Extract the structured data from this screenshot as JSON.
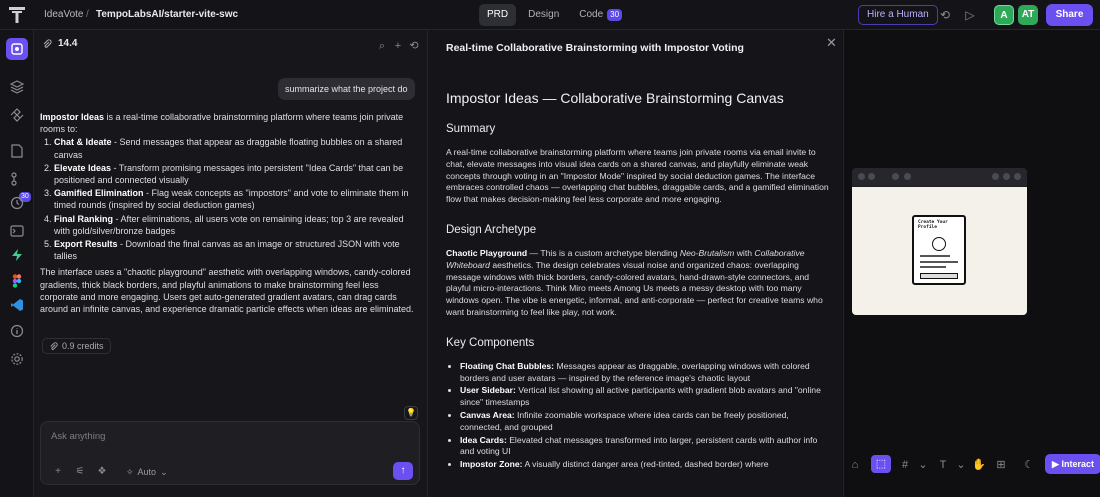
{
  "topbar": {
    "project": "IdeaVote",
    "separator": "/",
    "repo": "TempoLabsAI/starter-vite-swc",
    "tabs": [
      {
        "label": "PRD",
        "active": true
      },
      {
        "label": "Design",
        "active": false
      },
      {
        "label": "Code",
        "active": false,
        "badge": "30"
      }
    ],
    "hire_label": "Hire a Human",
    "avatars": [
      {
        "initials": "A",
        "color": "#2fa85a"
      },
      {
        "initials": "AT",
        "color": "#2fa85a"
      }
    ],
    "share_label": "Share"
  },
  "rail": {
    "code_badge": "30"
  },
  "chat": {
    "credits_count": "14.4",
    "user_message": "summarize what the project do",
    "answer": {
      "intro_bold": "Impostor Ideas",
      "intro_rest": " is a real-time collaborative brainstorming platform where teams join private rooms to:",
      "items": [
        {
          "title": "Chat & Ideate",
          "text": " - Send messages that appear as draggable floating bubbles on a shared canvas"
        },
        {
          "title": "Elevate Ideas",
          "text": " - Transform promising messages into persistent \"Idea Cards\" that can be positioned and connected visually"
        },
        {
          "title": "Gamified Elimination",
          "text": " - Flag weak concepts as \"impostors\" and vote to eliminate them in timed rounds (inspired by social deduction games)"
        },
        {
          "title": "Final Ranking",
          "text": " - After eliminations, all users vote on remaining ideas; top 3 are revealed with gold/silver/bronze badges"
        },
        {
          "title": "Export Results",
          "text": " - Download the final canvas as an image or structured JSON with vote tallies"
        }
      ],
      "outro": "The interface uses a \"chaotic playground\" aesthetic with overlapping windows, candy-colored gradients, thick black borders, and playful animations to make brainstorming feel less corporate and more engaging. Users get auto-generated gradient avatars, can drag cards around an infinite canvas, and experience dramatic particle effects when ideas are eliminated."
    },
    "credits_used": "0.9 credits",
    "input_placeholder": "Ask anything",
    "mode_label": "Auto"
  },
  "doc": {
    "panel_title": "Real-time Collaborative Brainstorming with Impostor Voting",
    "h1": "Impostor Ideas — Collaborative Brainstorming Canvas",
    "summary_heading": "Summary",
    "summary": "A real-time collaborative brainstorming platform where teams join private rooms via email invite to chat, elevate messages into visual idea cards on a shared canvas, and playfully eliminate weak concepts through voting in an \"Impostor Mode\" inspired by social deduction games. The interface embraces controlled chaos — overlapping chat bubbles, draggable cards, and a gamified elimination flow that makes decision-making feel less corporate and more engaging.",
    "archetype_heading": "Design Archetype",
    "archetype_bold": "Chaotic Playground",
    "archetype_pre": " — This is a custom archetype blending ",
    "archetype_em1": "Neo-Brutalism",
    "archetype_mid": " with ",
    "archetype_em2": "Collaborative Whiteboard",
    "archetype_rest": " aesthetics. The design celebrates visual noise and organized chaos: overlapping message windows with thick borders, candy-colored avatars, hand-drawn-style connectors, and playful micro-interactions. Think Miro meets Among Us meets a messy desktop with too many windows open. The vibe is energetic, informal, and anti-corporate — perfect for creative teams who want brainstorming to feel like play, not work.",
    "components_heading": "Key Components",
    "components": [
      {
        "title": "Floating Chat Bubbles:",
        "text": " Messages appear as draggable, overlapping windows with colored borders and user avatars — inspired by the reference image's chaotic layout"
      },
      {
        "title": "User Sidebar:",
        "text": " Vertical list showing all active participants with gradient blob avatars and \"online since\" timestamps"
      },
      {
        "title": "Canvas Area:",
        "text": " Infinite zoomable workspace where idea cards can be freely positioned, connected, and grouped"
      },
      {
        "title": "Idea Cards:",
        "text": " Elevated chat messages transformed into larger, persistent cards with author info and voting UI"
      },
      {
        "title": "Impostor Zone:",
        "text": " A visually distinct danger area (red-tinted, dashed border) where"
      }
    ]
  },
  "preview": {
    "card_title": "Create Your Profile",
    "interact_label": "Interact"
  },
  "colors": {
    "accent": "#6b4ff0",
    "avatar_green": "#2fa85a"
  }
}
